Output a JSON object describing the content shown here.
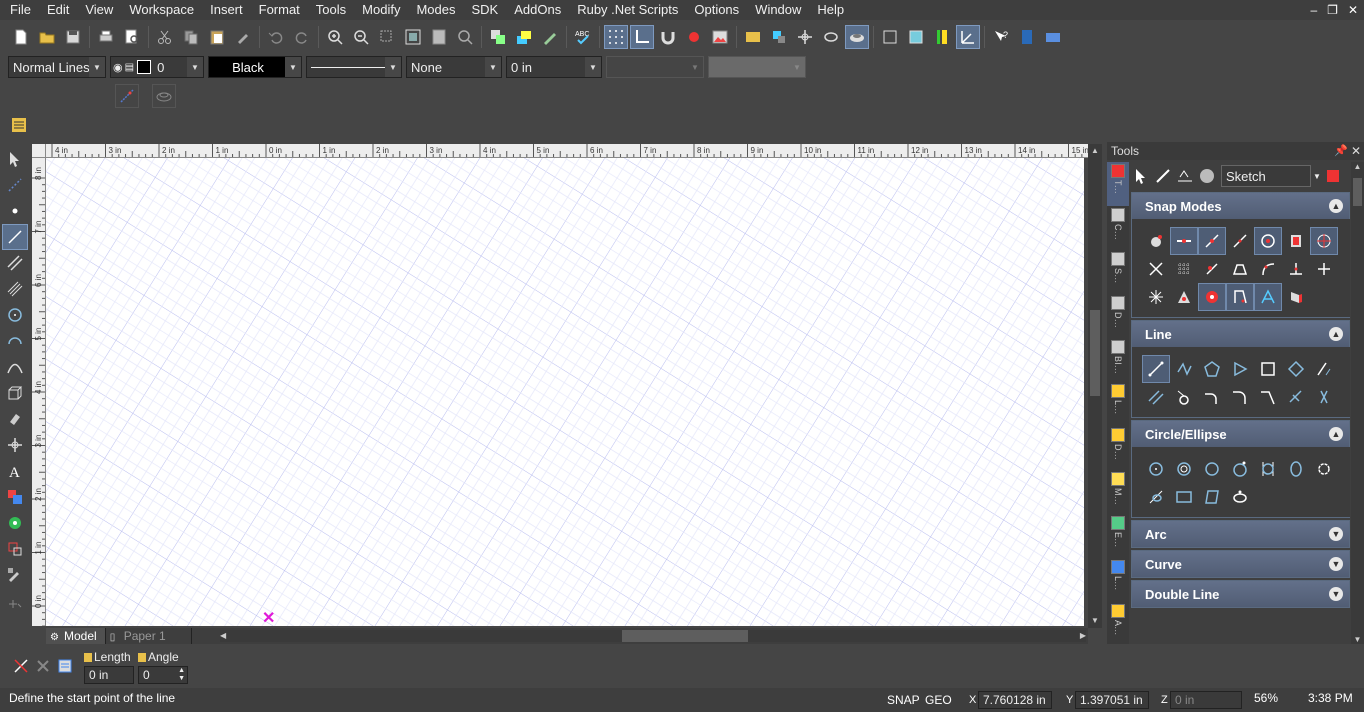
{
  "menu": [
    "File",
    "Edit",
    "View",
    "Workspace",
    "Insert",
    "Format",
    "Tools",
    "Modify",
    "Modes",
    "SDK",
    "AddOns",
    "Ruby .Net Scripts",
    "Options",
    "Window",
    "Help"
  ],
  "window_controls": {
    "minimize": "–",
    "restore": "❐",
    "close": "✕"
  },
  "properties": {
    "line_style": "Normal Lines",
    "line_width": "0",
    "color": "Black",
    "color_hex": "#000000",
    "arrow": "None",
    "offset": "0 in"
  },
  "ruler_top": [
    "4 in",
    "3 in",
    "2 in",
    "1 in",
    "0 in",
    "1 in",
    "2 in",
    "3 in",
    "4 in",
    "5 in",
    "6 in",
    "7 in",
    "8 in",
    "9 in",
    "10 in",
    "11 in",
    "12 in",
    "13 in",
    "14 in",
    "15 in"
  ],
  "ruler_left": [
    "8 in",
    "7 in",
    "6 in",
    "5 in",
    "4 in",
    "3 in",
    "2 in",
    "1 in",
    "0 in"
  ],
  "tabs": {
    "model": "Model",
    "paper": "Paper 1"
  },
  "tools_panel": {
    "title": "Tools",
    "palette": "Sketch",
    "side_tabs": [
      "T...",
      "C...",
      "S...",
      "D...",
      "Bl...",
      "L...",
      "D...",
      "M...",
      "E...",
      "L...",
      "A..."
    ],
    "sections": {
      "snap": "Snap Modes",
      "line": "Line",
      "circle": "Circle/Ellipse",
      "arc": "Arc",
      "curve": "Curve",
      "more": "Double Line"
    }
  },
  "command": {
    "length_label": "Length",
    "length_value": "0 in",
    "angle_label": "Angle",
    "angle_value": "0"
  },
  "status": {
    "prompt": "Define the start point of the line",
    "snap": "SNAP",
    "geo": "GEO",
    "x_label": "X",
    "x_value": "7.760128 in",
    "y_label": "Y",
    "y_value": "1.397051 in",
    "z_label": "Z",
    "z_value": "0 in",
    "zoom": "56%",
    "time": "3:38 PM"
  },
  "colors": {
    "accent": "#5a6f8c",
    "grid": "#b9bdf0",
    "cursor_marker": "#e01ad8"
  }
}
